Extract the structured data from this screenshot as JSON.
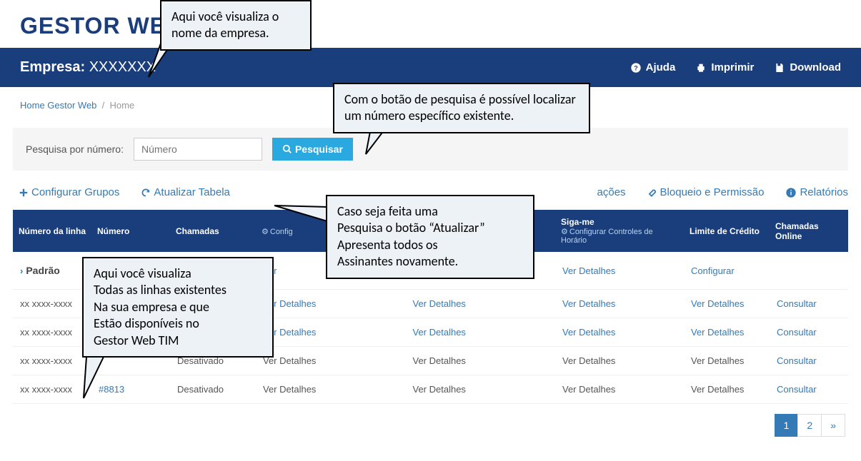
{
  "logo": "GESTOR WEB",
  "company": {
    "label": "Empresa: ",
    "value": "XXXXXXX"
  },
  "topbar": {
    "help": "Ajuda",
    "print": "Imprimir",
    "download": "Download"
  },
  "breadcrumb": {
    "home_link": "Home Gestor Web",
    "current": "Home"
  },
  "search": {
    "label": "Pesquisa por número:",
    "placeholder": "Número",
    "button": "Pesquisar"
  },
  "actions": {
    "configure_groups": "Configurar Grupos",
    "refresh_table": "Atualizar Tabela",
    "notifications": "ações",
    "block_permission": "Bloqueio e Permissão",
    "reports": "Relatórios"
  },
  "table": {
    "headers": {
      "line_number": "Número da linha",
      "absolute_number": "Número",
      "remote_calls": "Chamadas",
      "config": "Config",
      "col5": "",
      "follow_me": "Siga-me",
      "follow_me_sub": "Configurar Controles de Horário",
      "credit_limit": "Limite de Crédito",
      "online_calls": "Chamadas Online"
    },
    "rows": [
      {
        "line": "Padrão",
        "abs": "",
        "status": "",
        "c1": "Ver",
        "c2": "",
        "follow": "Ver Detalhes",
        "credit": "Configurar",
        "online": "",
        "linkrow": true
      },
      {
        "line": "xx xxxx-xxxx",
        "abs": "",
        "status": "",
        "c1": "Ver Detalhes",
        "c2": "Ver Detalhes",
        "follow": "Ver Detalhes",
        "credit": "Ver Detalhes",
        "online": "Consultar",
        "linkrow": true
      },
      {
        "line": "xx xxxx-xxxx",
        "abs": "",
        "status": "",
        "c1": "Ver Detalhes",
        "c2": "Ver Detalhes",
        "follow": "Ver Detalhes",
        "credit": "Ver Detalhes",
        "online": "Consultar",
        "linkrow": true
      },
      {
        "line": "xx xxxx-xxxx",
        "abs": "",
        "status": "Desativado",
        "c1": "Ver Detalhes",
        "c2": "Ver Detalhes",
        "follow": "Ver Detalhes",
        "credit": "Ver Detalhes",
        "online": "Consultar",
        "linkrow": false
      },
      {
        "line": "xx xxxx-xxxx",
        "abs": "#8813",
        "status": "Desativado",
        "c1": "Ver Detalhes",
        "c2": "Ver Detalhes",
        "follow": "Ver Detalhes",
        "credit": "Ver Detalhes",
        "online": "Consultar",
        "linkrow": false
      }
    ]
  },
  "pagination": {
    "p1": "1",
    "p2": "2",
    "next": "»"
  },
  "callouts": {
    "c1": "Aqui você visualiza o nome da empresa.",
    "c2": "Com o botão de pesquisa é possível localizar um número específico existente.",
    "c3": "Aqui você  visualiza\nTodas as linhas existentes\nNa sua empresa e que\nEstão disponíveis no\nGestor Web TIM",
    "c4": "Caso seja feita uma\nPesquisa o botão “Atualizar”\nApresenta todos os\nAssinantes novamente."
  }
}
